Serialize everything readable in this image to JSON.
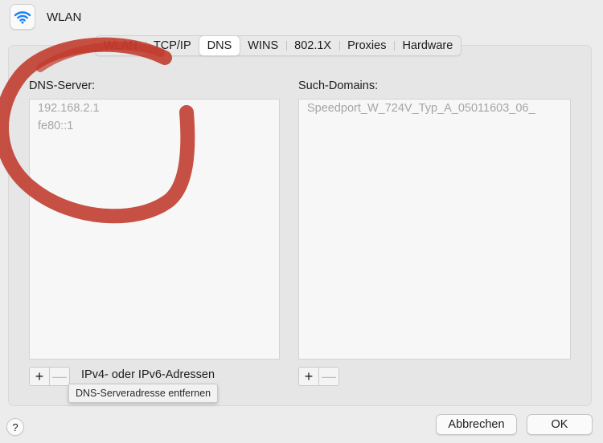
{
  "window": {
    "title": "WLAN",
    "icon": "wifi-icon"
  },
  "tabs": [
    {
      "label": "WLAN",
      "selected": false
    },
    {
      "label": "TCP/IP",
      "selected": false
    },
    {
      "label": "DNS",
      "selected": true
    },
    {
      "label": "WINS",
      "selected": false
    },
    {
      "label": "802.1X",
      "selected": false
    },
    {
      "label": "Proxies",
      "selected": false
    },
    {
      "label": "Hardware",
      "selected": false
    }
  ],
  "dns_servers": {
    "label": "DNS-Server:",
    "items": [
      "192.168.2.1",
      "fe80::1"
    ],
    "hint": "IPv4- oder IPv6-Adressen",
    "add_label": "+",
    "remove_label": "—",
    "tooltip": "DNS-Serveradresse entfernen"
  },
  "search_domains": {
    "label": "Such-Domains:",
    "items": [
      "Speedport_W_724V_Typ_A_05011603_06_"
    ],
    "add_label": "+",
    "remove_label": "—"
  },
  "footer": {
    "help_label": "?",
    "cancel_label": "Abbrechen",
    "ok_label": "OK"
  },
  "colors": {
    "scribble": "#c0392b",
    "accent_wifi": "#1a82fb"
  }
}
